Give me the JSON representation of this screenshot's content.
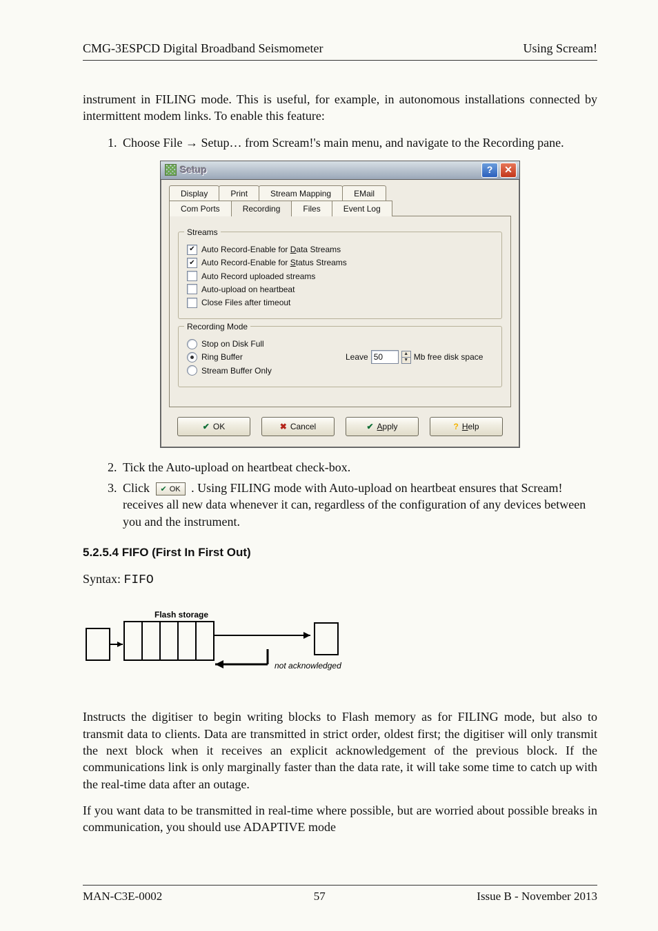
{
  "header": {
    "left": "CMG-3ESPCD Digital Broadband Seismometer",
    "right": "Using Scream!"
  },
  "intro_para": "instrument in FILING mode.  This is useful, for example, in autonomous installations connected by intermittent modem links.  To enable this feature:",
  "steps_a": {
    "one_pre": "Choose File ",
    "one_arrow": "→",
    "one_post": " Setup… from Scream!'s main menu, and navigate to the Recording pane."
  },
  "dialog": {
    "title": "Setup",
    "help_glyph": "?",
    "close_glyph": "✕",
    "tabs_row1": [
      "Display",
      "Print",
      "Stream Mapping",
      "EMail"
    ],
    "tabs_row2": [
      "Com Ports",
      "Recording",
      "Files",
      "Event Log"
    ],
    "active_tab": "Recording",
    "streams_legend": "Streams",
    "checks": [
      {
        "checked": true,
        "pre": "Auto Record-Enable for ",
        "u": "D",
        "post": "ata Streams"
      },
      {
        "checked": true,
        "pre": "Auto Record-Enable for ",
        "u": "S",
        "post": "tatus Streams"
      },
      {
        "checked": false,
        "pre": "Auto Record uploaded streams",
        "u": "",
        "post": ""
      },
      {
        "checked": false,
        "pre": "Auto-upload on heartbeat",
        "u": "",
        "post": ""
      },
      {
        "checked": false,
        "pre": "Close Files after timeout",
        "u": "",
        "post": ""
      }
    ],
    "recmode_legend": "Recording Mode",
    "radios": [
      {
        "sel": false,
        "label": "Stop on Disk Full"
      },
      {
        "sel": true,
        "label": "Ring Buffer"
      },
      {
        "sel": false,
        "label": "Stream Buffer Only"
      }
    ],
    "leave_label": "Leave",
    "leave_value": "50",
    "leave_unit": "Mb free disk space",
    "buttons": {
      "ok": {
        "glyph": "✔",
        "label": "OK"
      },
      "cancel": {
        "glyph": "✖",
        "label": "Cancel"
      },
      "apply": {
        "glyph": "✔",
        "label": "Apply",
        "u": "A"
      },
      "help": {
        "glyph": "?",
        "label": "Help",
        "u": "H"
      }
    }
  },
  "steps_b": {
    "two": "Tick the Auto-upload on heartbeat check-box.",
    "three_pre": "Click ",
    "three_btn_glyph": "✔",
    "three_btn_label": "OK",
    "three_post": ". Using FILING mode with Auto-upload on heartbeat ensures that Scream! receives all new data whenever it can, regardless of the configuration of any devices between you and the instrument."
  },
  "fifo": {
    "heading": "5.2.5.4  FIFO (First In First Out)",
    "syntax_label": "Syntax: ",
    "syntax_code": "FIFO",
    "sketch_label_top": "Flash storage",
    "sketch_label_arrow": "not acknowledged"
  },
  "fifo_paras": [
    "Instructs the digitiser to begin writing blocks to Flash memory as for FILING mode, but also to transmit data to clients.  Data are transmitted in strict order, oldest first; the digitiser will only transmit the next block when it receives an explicit acknowledgement of the previous block.  If the communications link is only marginally faster than the data rate, it will take some time to catch up with the real-time data after an outage.",
    "If you want data to be transmitted in real-time where possible, but are worried about possible breaks in communication, you should use ADAPTIVE mode"
  ],
  "footer": {
    "left": "MAN-C3E-0002",
    "center": "57",
    "right": "Issue B  - November 2013"
  }
}
